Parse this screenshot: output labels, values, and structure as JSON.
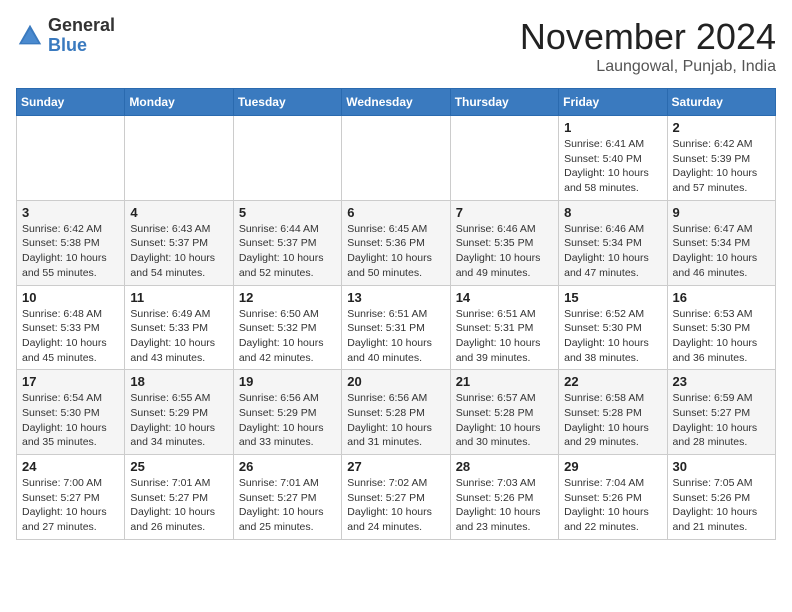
{
  "header": {
    "logo_general": "General",
    "logo_blue": "Blue",
    "month_title": "November 2024",
    "location": "Laungowal, Punjab, India"
  },
  "weekdays": [
    "Sunday",
    "Monday",
    "Tuesday",
    "Wednesday",
    "Thursday",
    "Friday",
    "Saturday"
  ],
  "weeks": [
    [
      {
        "day": "",
        "detail": ""
      },
      {
        "day": "",
        "detail": ""
      },
      {
        "day": "",
        "detail": ""
      },
      {
        "day": "",
        "detail": ""
      },
      {
        "day": "",
        "detail": ""
      },
      {
        "day": "1",
        "detail": "Sunrise: 6:41 AM\nSunset: 5:40 PM\nDaylight: 10 hours\nand 58 minutes."
      },
      {
        "day": "2",
        "detail": "Sunrise: 6:42 AM\nSunset: 5:39 PM\nDaylight: 10 hours\nand 57 minutes."
      }
    ],
    [
      {
        "day": "3",
        "detail": "Sunrise: 6:42 AM\nSunset: 5:38 PM\nDaylight: 10 hours\nand 55 minutes."
      },
      {
        "day": "4",
        "detail": "Sunrise: 6:43 AM\nSunset: 5:37 PM\nDaylight: 10 hours\nand 54 minutes."
      },
      {
        "day": "5",
        "detail": "Sunrise: 6:44 AM\nSunset: 5:37 PM\nDaylight: 10 hours\nand 52 minutes."
      },
      {
        "day": "6",
        "detail": "Sunrise: 6:45 AM\nSunset: 5:36 PM\nDaylight: 10 hours\nand 50 minutes."
      },
      {
        "day": "7",
        "detail": "Sunrise: 6:46 AM\nSunset: 5:35 PM\nDaylight: 10 hours\nand 49 minutes."
      },
      {
        "day": "8",
        "detail": "Sunrise: 6:46 AM\nSunset: 5:34 PM\nDaylight: 10 hours\nand 47 minutes."
      },
      {
        "day": "9",
        "detail": "Sunrise: 6:47 AM\nSunset: 5:34 PM\nDaylight: 10 hours\nand 46 minutes."
      }
    ],
    [
      {
        "day": "10",
        "detail": "Sunrise: 6:48 AM\nSunset: 5:33 PM\nDaylight: 10 hours\nand 45 minutes."
      },
      {
        "day": "11",
        "detail": "Sunrise: 6:49 AM\nSunset: 5:33 PM\nDaylight: 10 hours\nand 43 minutes."
      },
      {
        "day": "12",
        "detail": "Sunrise: 6:50 AM\nSunset: 5:32 PM\nDaylight: 10 hours\nand 42 minutes."
      },
      {
        "day": "13",
        "detail": "Sunrise: 6:51 AM\nSunset: 5:31 PM\nDaylight: 10 hours\nand 40 minutes."
      },
      {
        "day": "14",
        "detail": "Sunrise: 6:51 AM\nSunset: 5:31 PM\nDaylight: 10 hours\nand 39 minutes."
      },
      {
        "day": "15",
        "detail": "Sunrise: 6:52 AM\nSunset: 5:30 PM\nDaylight: 10 hours\nand 38 minutes."
      },
      {
        "day": "16",
        "detail": "Sunrise: 6:53 AM\nSunset: 5:30 PM\nDaylight: 10 hours\nand 36 minutes."
      }
    ],
    [
      {
        "day": "17",
        "detail": "Sunrise: 6:54 AM\nSunset: 5:30 PM\nDaylight: 10 hours\nand 35 minutes."
      },
      {
        "day": "18",
        "detail": "Sunrise: 6:55 AM\nSunset: 5:29 PM\nDaylight: 10 hours\nand 34 minutes."
      },
      {
        "day": "19",
        "detail": "Sunrise: 6:56 AM\nSunset: 5:29 PM\nDaylight: 10 hours\nand 33 minutes."
      },
      {
        "day": "20",
        "detail": "Sunrise: 6:56 AM\nSunset: 5:28 PM\nDaylight: 10 hours\nand 31 minutes."
      },
      {
        "day": "21",
        "detail": "Sunrise: 6:57 AM\nSunset: 5:28 PM\nDaylight: 10 hours\nand 30 minutes."
      },
      {
        "day": "22",
        "detail": "Sunrise: 6:58 AM\nSunset: 5:28 PM\nDaylight: 10 hours\nand 29 minutes."
      },
      {
        "day": "23",
        "detail": "Sunrise: 6:59 AM\nSunset: 5:27 PM\nDaylight: 10 hours\nand 28 minutes."
      }
    ],
    [
      {
        "day": "24",
        "detail": "Sunrise: 7:00 AM\nSunset: 5:27 PM\nDaylight: 10 hours\nand 27 minutes."
      },
      {
        "day": "25",
        "detail": "Sunrise: 7:01 AM\nSunset: 5:27 PM\nDaylight: 10 hours\nand 26 minutes."
      },
      {
        "day": "26",
        "detail": "Sunrise: 7:01 AM\nSunset: 5:27 PM\nDaylight: 10 hours\nand 25 minutes."
      },
      {
        "day": "27",
        "detail": "Sunrise: 7:02 AM\nSunset: 5:27 PM\nDaylight: 10 hours\nand 24 minutes."
      },
      {
        "day": "28",
        "detail": "Sunrise: 7:03 AM\nSunset: 5:26 PM\nDaylight: 10 hours\nand 23 minutes."
      },
      {
        "day": "29",
        "detail": "Sunrise: 7:04 AM\nSunset: 5:26 PM\nDaylight: 10 hours\nand 22 minutes."
      },
      {
        "day": "30",
        "detail": "Sunrise: 7:05 AM\nSunset: 5:26 PM\nDaylight: 10 hours\nand 21 minutes."
      }
    ]
  ]
}
